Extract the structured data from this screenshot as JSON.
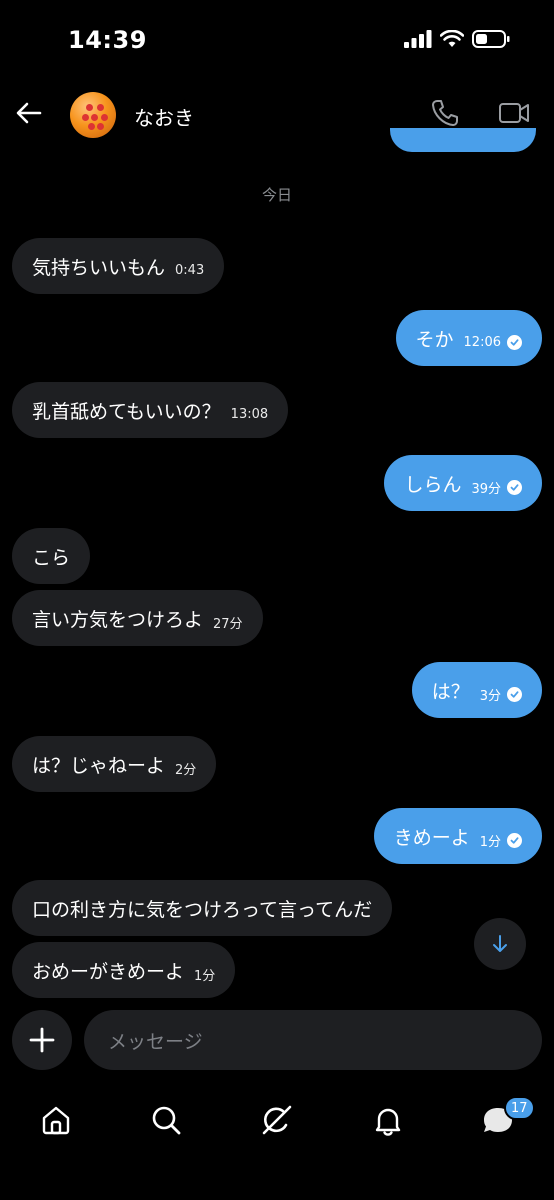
{
  "status": {
    "time": "14:39"
  },
  "header": {
    "contact_name": "なおき"
  },
  "date_divider": "今日",
  "messages": [
    {
      "dir": "in",
      "text": "気持ちいいもん",
      "time": "0:43"
    },
    {
      "dir": "out",
      "text": "そか",
      "time": "12:06"
    },
    {
      "dir": "in",
      "text": "乳首舐めてもいいの？",
      "time": "13:08"
    },
    {
      "dir": "out",
      "text": "しらん",
      "time": "39分"
    },
    {
      "dir": "in",
      "text": "こら",
      "time": ""
    },
    {
      "dir": "in",
      "text": "言い方気をつけろよ",
      "time": "27分"
    },
    {
      "dir": "out",
      "text": "は？",
      "time": "3分"
    },
    {
      "dir": "in",
      "text": "は？じゃねーよ",
      "time": "2分"
    },
    {
      "dir": "out",
      "text": "きめーよ",
      "time": "1分"
    },
    {
      "dir": "in",
      "text": "口の利き方に気をつけろって言ってんだ",
      "time": ""
    },
    {
      "dir": "in",
      "text": "おめーがきめーよ",
      "time": "1分"
    }
  ],
  "composer": {
    "placeholder": "メッセージ"
  },
  "tabs": {
    "messages_badge": "17"
  },
  "colors": {
    "accent": "#4a9fea",
    "incoming_bubble": "#1e1f22",
    "background": "#000000"
  },
  "icons": [
    "back-arrow-icon",
    "phone-icon",
    "video-camera-icon",
    "arrow-down-icon",
    "plus-icon",
    "home-icon",
    "search-icon",
    "grok-icon",
    "bell-icon",
    "messages-icon"
  ]
}
